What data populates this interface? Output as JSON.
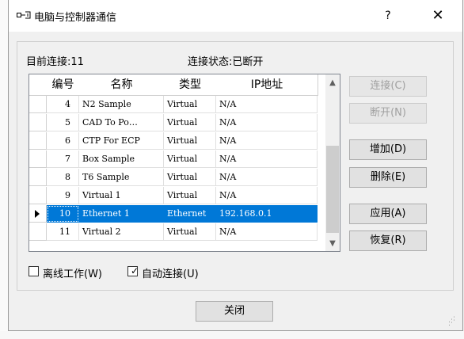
{
  "title": "电脑与控制器通信",
  "help_label": "?",
  "close_glyph": "✕",
  "current_connection": "目前连接:11",
  "connection_status": "连接状态:已断开",
  "table": {
    "headers": [
      "编号",
      "名称",
      "类型",
      "IP地址"
    ],
    "rows": [
      {
        "num": "4",
        "name": "N2 Sample",
        "type": "Virtual",
        "ip": "N/A",
        "selected": false
      },
      {
        "num": "5",
        "name": "CAD To Po…",
        "type": "Virtual",
        "ip": "N/A",
        "selected": false
      },
      {
        "num": "6",
        "name": "CTP For ECP",
        "type": "Virtual",
        "ip": "N/A",
        "selected": false
      },
      {
        "num": "7",
        "name": "Box Sample",
        "type": "Virtual",
        "ip": "N/A",
        "selected": false
      },
      {
        "num": "8",
        "name": "T6 Sample",
        "type": "Virtual",
        "ip": "N/A",
        "selected": false
      },
      {
        "num": "9",
        "name": "Virtual 1",
        "type": "Virtual",
        "ip": "N/A",
        "selected": false
      },
      {
        "num": "10",
        "name": "Ethernet 1",
        "type": "Ethernet",
        "ip": "192.168.0.1",
        "selected": true
      },
      {
        "num": "11",
        "name": "Virtual 2",
        "type": "Virtual",
        "ip": "N/A",
        "selected": false
      }
    ]
  },
  "buttons": {
    "connect": "连接(C)",
    "disconnect": "断开(N)",
    "add": "增加(D)",
    "delete": "删除(E)",
    "apply": "应用(A)",
    "restore": "恢复(R)"
  },
  "offline_work": "离线工作(W)",
  "offline_checked": false,
  "auto_connect": "自动连接(U)",
  "auto_checked": true,
  "close_button": "关闭"
}
